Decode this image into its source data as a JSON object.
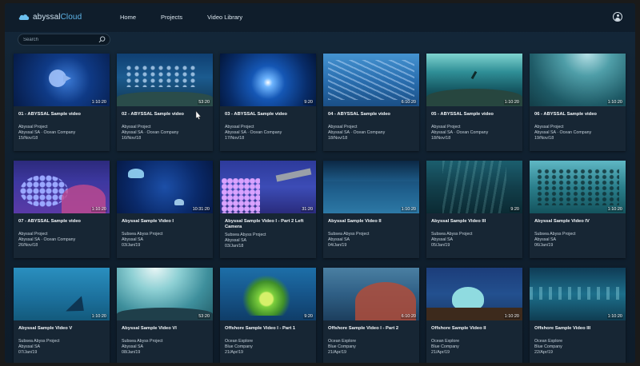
{
  "app": {
    "logo_part1": "abyssal",
    "logo_part2": "Cloud",
    "logo_icon": "cloud-icon"
  },
  "nav": {
    "items": [
      "Home",
      "Projects",
      "Video Library"
    ]
  },
  "header": {
    "user_icon": "user-icon"
  },
  "search": {
    "placeholder": "Search",
    "value": "",
    "icon": "search-icon"
  },
  "videos": [
    {
      "title": "01 - ABYSSAL Sample video",
      "duration": "1:10:20",
      "project": "Abyssal Project",
      "company": "Abyssal SA · Ocean Company",
      "date": "15/Nov/18"
    },
    {
      "title": "02 - ABYSSAL Sample video",
      "duration": "53:20",
      "project": "Abyssal Project",
      "company": "Abyssal SA · Ocean Company",
      "date": "16/Nov/18"
    },
    {
      "title": "03 - ABYSSAL Sample video",
      "duration": "9:20",
      "project": "Abyssal Project",
      "company": "Abyssal SA · Ocean Company",
      "date": "17/Nov/18"
    },
    {
      "title": "04 - ABYSSAL Sample video",
      "duration": "6:10:20",
      "project": "Abyssal Project",
      "company": "Abyssal SA · Ocean Company",
      "date": "18/Nov/18"
    },
    {
      "title": "05 - ABYSSAL Sample video",
      "duration": "1:10:20",
      "project": "Abyssal Project",
      "company": "Abyssal SA · Ocean Company",
      "date": "18/Nov/18"
    },
    {
      "title": "06 - ABYSSAL Sample video",
      "duration": "1:10:20",
      "project": "Abyssal Project",
      "company": "Abyssal SA · Ocean Company",
      "date": "19/Nov/18"
    },
    {
      "title": "07 - ABYSSAL Sample video",
      "duration": "1:10:20",
      "project": "Abyssal Project",
      "company": "Abyssal SA · Ocean Company",
      "date": "26/Nov/18"
    },
    {
      "title": "Abyssal Sample Video I",
      "duration": "10:31:20",
      "project": "Subsea Abyss Project",
      "company": "Abyssal SA",
      "date": "03/Jan/19"
    },
    {
      "title": "Abyssal Sample Video I - Part 2 Left Camera",
      "duration": "31:20",
      "project": "Subsea Abyss Project",
      "company": "Abyssal SA",
      "date": "03/Jan/18"
    },
    {
      "title": "Abyssal Sample Video II",
      "duration": "1:10:20",
      "project": "Subsea Abyss Project",
      "company": "Abyssal SA",
      "date": "04/Jan/19"
    },
    {
      "title": "Abyssal Sample Video III",
      "duration": "9:20",
      "project": "Subsea Abyss Project",
      "company": "Abyssal SA",
      "date": "05/Jan/19"
    },
    {
      "title": "Abyssal Sample Video IV",
      "duration": "1:10:20",
      "project": "Subsea Abyss Project",
      "company": "Abyssal SA",
      "date": "06/Jan/19"
    },
    {
      "title": "Abyssal Sample Video V",
      "duration": "1:10:20",
      "project": "Subsea Abyss Project",
      "company": "Abyssal SA",
      "date": "07/Jan/19"
    },
    {
      "title": "Abyssal Sample Video VI",
      "duration": "53:20",
      "project": "Subsea Abyss Project",
      "company": "Abyssal SA",
      "date": "08/Jan/19"
    },
    {
      "title": "Offshore Sample Video I - Part 1",
      "duration": "9:20",
      "project": "Ocean Explore",
      "company": "Blue Company",
      "date": "21/Apr/19"
    },
    {
      "title": "Offshore Sample Video I - Part 2",
      "duration": "6:10:20",
      "project": "Ocean Explore",
      "company": "Blue Company",
      "date": "21/Apr/19"
    },
    {
      "title": "Offshore Sample Video II",
      "duration": "1:10:20",
      "project": "Ocean Explore",
      "company": "Blue Company",
      "date": "21/Apr/19"
    },
    {
      "title": "Offshore Sample Video III",
      "duration": "1:10:20",
      "project": "Ocean Explore",
      "company": "Blue Company",
      "date": "22/Apr/19"
    }
  ]
}
